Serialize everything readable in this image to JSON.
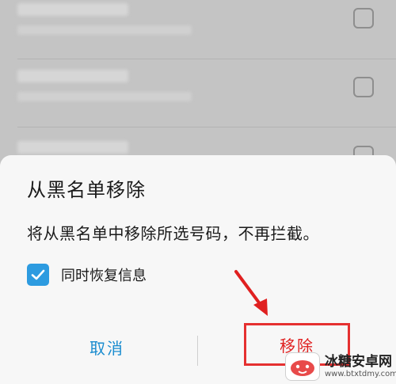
{
  "background_list": {
    "rows": [
      {
        "number": "",
        "detail": ""
      },
      {
        "number": "",
        "detail": ""
      },
      {
        "number": "",
        "detail": ""
      }
    ]
  },
  "dialog": {
    "title": "从黑名单移除",
    "message": "将从黑名单中移除所选号码，不再拦截。",
    "option": {
      "label": "同时恢复信息",
      "checked": true
    },
    "buttons": {
      "cancel": "取消",
      "remove": "移除"
    }
  },
  "colors": {
    "accent": "#2d9be0",
    "button_text": "#1a8ccf",
    "highlight": "#e53030"
  },
  "watermark": {
    "name": "冰糖安卓网",
    "url": "www.btxtdmy.com"
  }
}
